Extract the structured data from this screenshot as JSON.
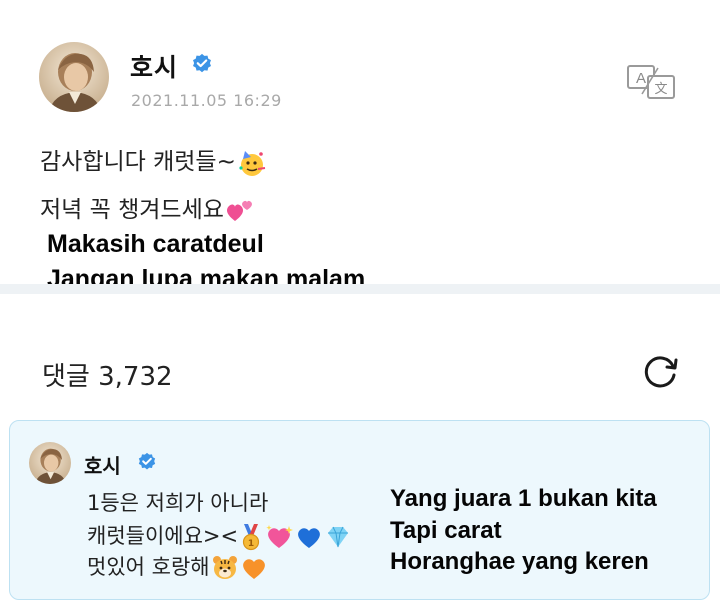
{
  "post": {
    "author": "호시",
    "timestamp": "2021.11.05 16:29",
    "line1": "감사합니다 캐럿들~",
    "line2": "저녁 꼭 챙겨드세요",
    "translation_line1": "Makasih caratdeul",
    "translation_line2": "Jangan lupa makan malam"
  },
  "comments": {
    "label_count": "댓글 3,732"
  },
  "comment": {
    "author": "호시",
    "line1": "1등은 저희가 아니라",
    "line2": "캐럿들이에요><",
    "line3": "멋있어 호랑해",
    "translation_line1": "Yang juara 1 bukan kita",
    "translation_line2": "Tapi carat",
    "translation_line3": "Horanghae yang keren"
  },
  "icons": {
    "verified": "verified-check-icon",
    "translate": "translate-icon",
    "refresh": "refresh-icon",
    "party_face": "party-face-emoji",
    "two_hearts": "two-hearts-emoji",
    "gold_medal": "gold-medal-emoji",
    "sparkling_heart": "sparkling-heart-emoji",
    "blue_heart": "blue-heart-emoji",
    "gem": "gem-emoji",
    "tiger_face": "tiger-face-emoji",
    "orange_heart": "orange-heart-emoji"
  },
  "colors": {
    "verified_blue": "#3c94e6",
    "timestamp_gray": "#a9a9a9",
    "comment_bg": "#edf8fd",
    "comment_border": "#bde1f2"
  }
}
